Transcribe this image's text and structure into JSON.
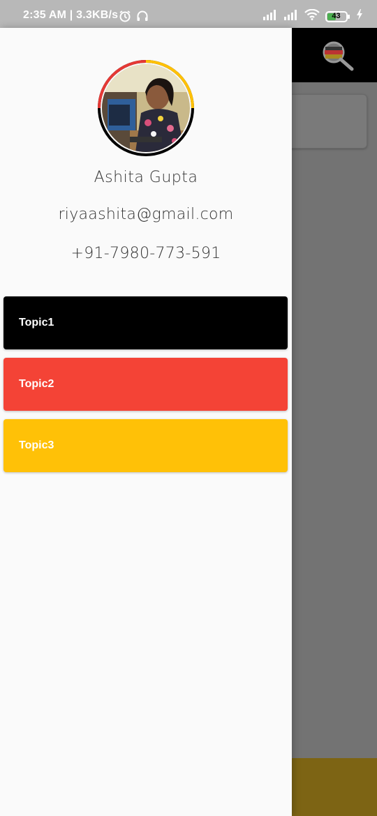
{
  "status_bar": {
    "time_speed": "2:35 AM | 3.3KB/s",
    "battery": "43",
    "icons": [
      "alarm-icon",
      "headphones-icon",
      "signal-icon",
      "signal-icon",
      "wifi-icon",
      "battery-icon",
      "charging-icon"
    ]
  },
  "app_bar": {
    "search_icon": "search-icon"
  },
  "drawer": {
    "profile": {
      "name": "Ashita Gupta",
      "email": "riyaashita@gmail.com",
      "phone": "+91-7980-773-591"
    },
    "topics": [
      {
        "label": "Topic1",
        "color": "#000000"
      },
      {
        "label": "Topic2",
        "color": "#f44336"
      },
      {
        "label": "Topic3",
        "color": "#ffc107"
      }
    ]
  },
  "colors": {
    "avatar_ring": [
      "#e53935",
      "#ffc107",
      "#000000"
    ],
    "status_bar": "#b8b8b8",
    "scrim": "#737373"
  }
}
